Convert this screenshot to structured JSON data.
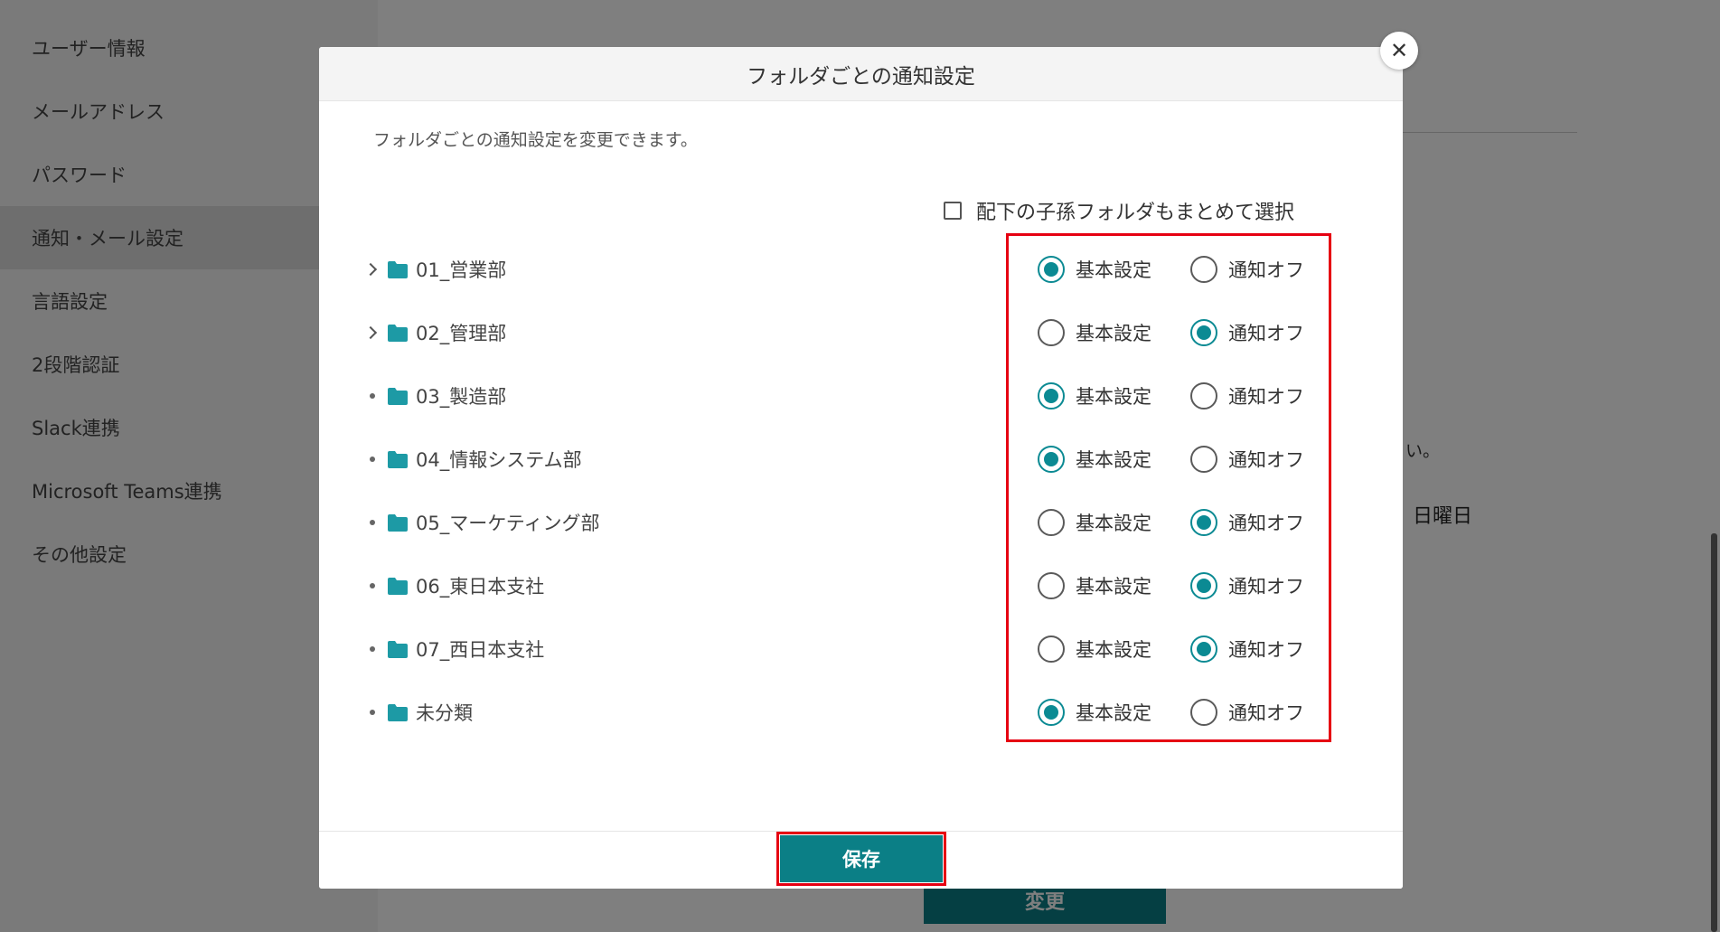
{
  "sidebar": {
    "items": [
      {
        "label": "ユーザー情報"
      },
      {
        "label": "メールアドレス"
      },
      {
        "label": "パスワード"
      },
      {
        "label": "通知・メール設定"
      },
      {
        "label": "言語設定"
      },
      {
        "label": "2段階認証"
      },
      {
        "label": "Slack連携"
      },
      {
        "label": "Microsoft Teams連携"
      },
      {
        "label": "その他設定"
      }
    ],
    "active_index": 3
  },
  "background": {
    "partial_text": "い。",
    "weekday_text": "日曜日",
    "change_button_label": "変更"
  },
  "modal": {
    "title": "フォルダごとの通知設定",
    "description": "フォルダごとの通知設定を変更できます。",
    "bulk_select_label": "配下の子孫フォルダもまとめて選択",
    "bulk_select_checked": false,
    "option_labels": {
      "basic": "基本設定",
      "off": "通知オフ"
    },
    "folders": [
      {
        "name": "01_営業部",
        "expandable": true,
        "selected": "basic"
      },
      {
        "name": "02_管理部",
        "expandable": true,
        "selected": "off"
      },
      {
        "name": "03_製造部",
        "expandable": false,
        "selected": "basic"
      },
      {
        "name": "04_情報システム部",
        "expandable": false,
        "selected": "basic"
      },
      {
        "name": "05_マーケティング部",
        "expandable": false,
        "selected": "off"
      },
      {
        "name": "06_東日本支社",
        "expandable": false,
        "selected": "off"
      },
      {
        "name": "07_西日本支社",
        "expandable": false,
        "selected": "off"
      },
      {
        "name": "未分類",
        "expandable": false,
        "selected": "basic"
      }
    ],
    "save_label": "保存",
    "close_symbol": "✕"
  },
  "colors": {
    "accent": "#0b8a93",
    "folder": "#1d9aa5",
    "highlight": "#e60012"
  },
  "icons": {
    "folder": "folder-icon",
    "expand": "chevron-right-icon",
    "leaf": "bullet-dot-icon",
    "close": "close-icon"
  }
}
